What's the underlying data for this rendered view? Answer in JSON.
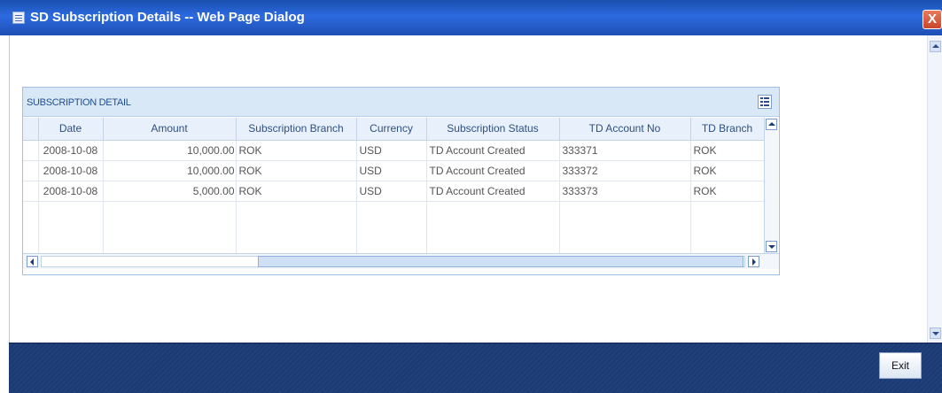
{
  "window": {
    "title": "SD Subscription Details -- Web Page Dialog",
    "close_label": "X"
  },
  "panel": {
    "title": "SUBSCRIPTION DETAIL"
  },
  "table": {
    "columns": [
      "Date",
      "Amount",
      "Subscription Branch",
      "Currency",
      "Subscription Status",
      "TD Account No",
      "TD Branch"
    ],
    "rows": [
      [
        "2008-10-08",
        "10,000.00",
        "ROK",
        "USD",
        "TD Account Created",
        "333371",
        "ROK"
      ],
      [
        "2008-10-08",
        "10,000.00",
        "ROK",
        "USD",
        "TD Account Created",
        "333372",
        "ROK"
      ],
      [
        "2008-10-08",
        "5,000.00",
        "ROK",
        "USD",
        "TD Account Created",
        "333373",
        "ROK"
      ]
    ]
  },
  "footer": {
    "exit_label": "Exit"
  }
}
